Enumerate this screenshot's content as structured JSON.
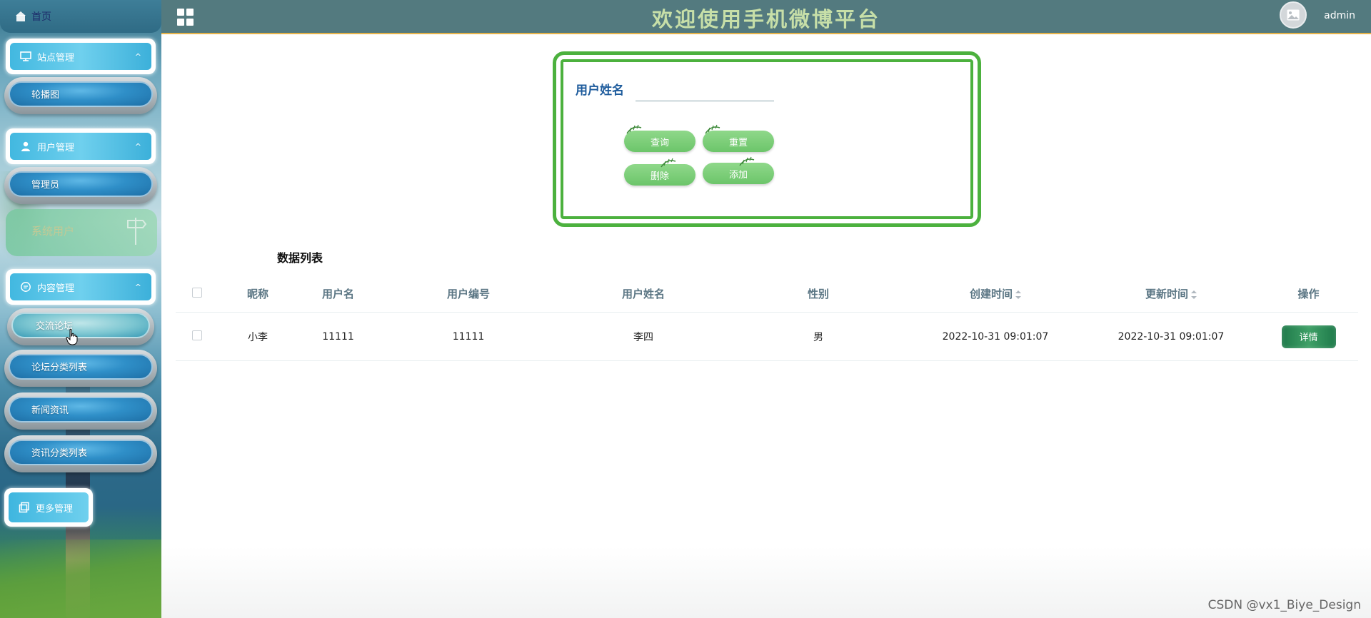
{
  "header": {
    "title": "欢迎使用手机微博平台",
    "username": "admin"
  },
  "sidebar": {
    "home": "首页",
    "groups": [
      {
        "label": "站点管理",
        "items": [
          "轮播图"
        ]
      },
      {
        "label": "用户管理",
        "items": [
          "管理员",
          "系统用户"
        ]
      },
      {
        "label": "内容管理",
        "items": [
          "交流论坛",
          "论坛分类列表",
          "新闻资讯",
          "资讯分类列表"
        ]
      }
    ],
    "more": "更多管理"
  },
  "search": {
    "label": "用户姓名",
    "value": "",
    "placeholder": "",
    "buttons": {
      "query": "查询",
      "reset": "重置",
      "delete": "删除",
      "add": "添加"
    }
  },
  "table": {
    "title": "数据列表",
    "columns": [
      "昵称",
      "用户名",
      "用户编号",
      "用户姓名",
      "性别",
      "创建时间",
      "更新时间",
      "操作"
    ],
    "rows": [
      {
        "nickname": "小李",
        "username": "11111",
        "user_no": "11111",
        "real_name": "李四",
        "gender": "男",
        "created": "2022-10-31 09:01:07",
        "updated": "2022-10-31 09:01:07",
        "action": "详情"
      }
    ]
  },
  "watermark": "CSDN @vx1_Biye_Design",
  "colors": {
    "topbar": "#537a7f",
    "accent_green": "#4cb13e",
    "title": "#c7dfa8"
  }
}
